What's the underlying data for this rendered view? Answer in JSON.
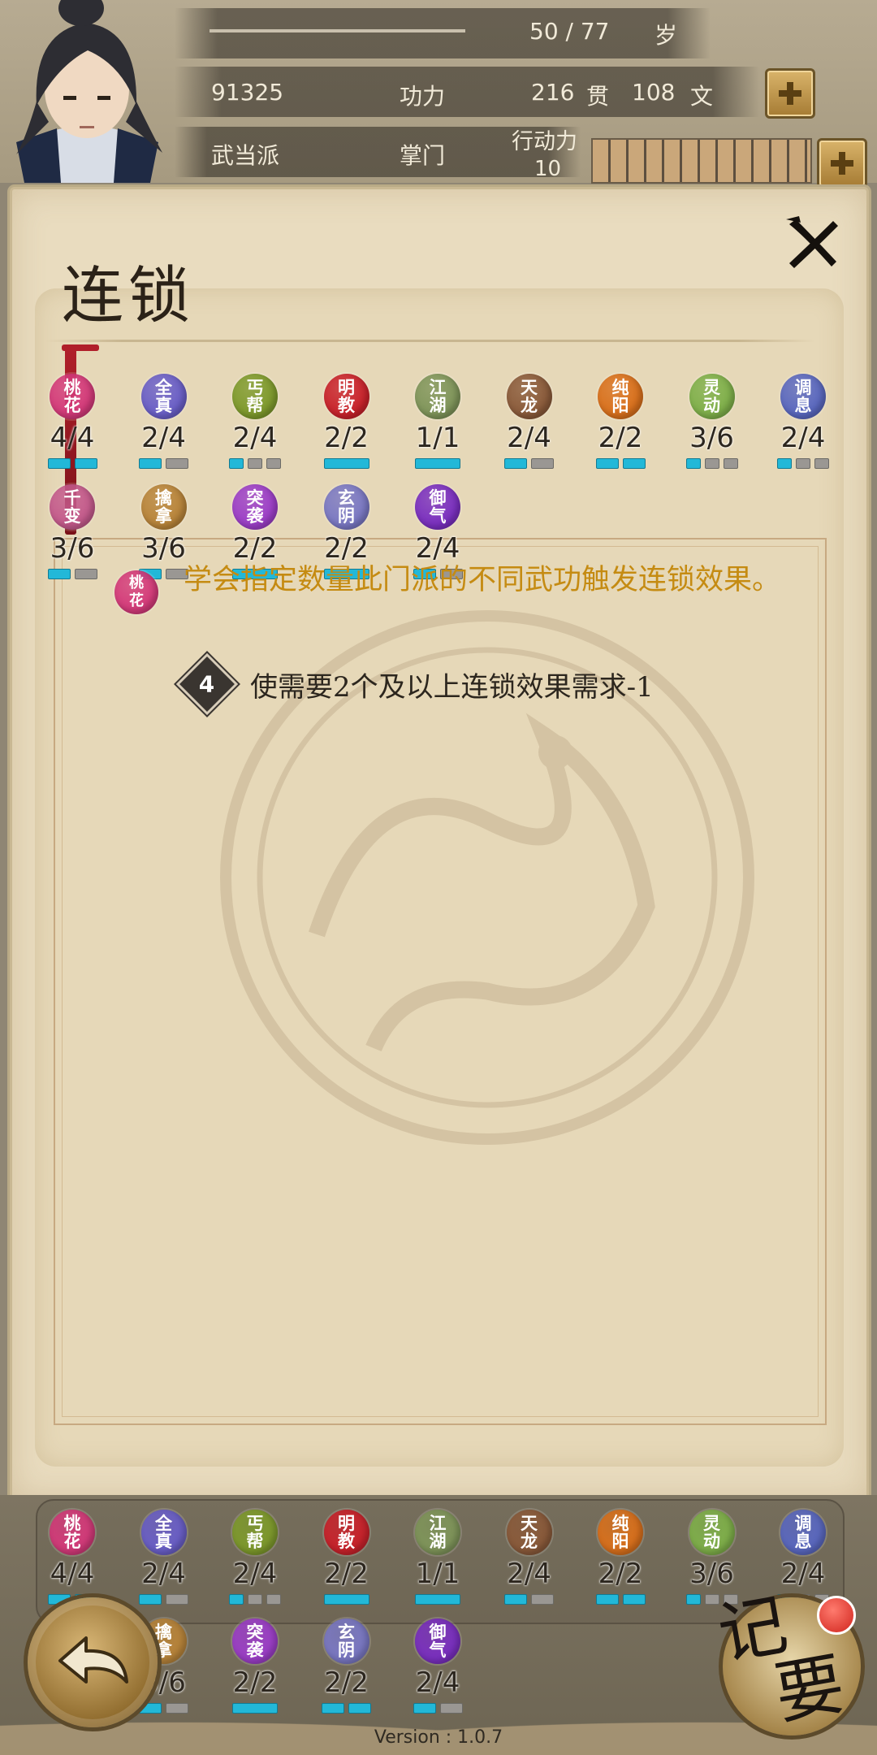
{
  "header": {
    "age": "50 / 77",
    "age_unit": "岁",
    "power_value": "91325",
    "power_label": "功力",
    "money_guan": "216",
    "guan_label": "贯",
    "money_wen": "108",
    "wen_label": "文",
    "sect": "武当派",
    "rank": "掌门",
    "action_label": "行动力",
    "action_value": "10",
    "action_fill": 1.0
  },
  "panel": {
    "title": "连锁"
  },
  "colors": {
    "pip_on": "#22b8d8",
    "pip_off": "#9a9793",
    "desc_gold": "#c58b12"
  },
  "sects": [
    {
      "name": "桃花",
      "count": "4/4",
      "on": 2,
      "total": 2,
      "color": "#d43a7a"
    },
    {
      "name": "全真",
      "count": "2/4",
      "on": 1,
      "total": 2,
      "color": "#6a5fc8"
    },
    {
      "name": "丐帮",
      "count": "2/4",
      "on": 1,
      "total": 3,
      "color": "#7e9a2c"
    },
    {
      "name": "明教",
      "count": "2/2",
      "on": 1,
      "total": 1,
      "color": "#c9222b"
    },
    {
      "name": "江湖",
      "count": "1/1",
      "on": 1,
      "total": 1,
      "color": "#7f955a"
    },
    {
      "name": "天龙",
      "count": "2/4",
      "on": 1,
      "total": 2,
      "color": "#8a5a3a"
    },
    {
      "name": "纯阳",
      "count": "2/2",
      "on": 2,
      "total": 2,
      "color": "#d9701c"
    },
    {
      "name": "灵动",
      "count": "3/6",
      "on": 1,
      "total": 3,
      "color": "#7fb04a"
    },
    {
      "name": "调息",
      "count": "2/4",
      "on": 1,
      "total": 3,
      "color": "#5a68c0"
    },
    {
      "name": "千变",
      "count": "3/6",
      "on": 1,
      "total": 2,
      "color": "#c45a8c"
    },
    {
      "name": "擒拿",
      "count": "3/6",
      "on": 1,
      "total": 2,
      "color": "#b8843a"
    },
    {
      "name": "突袭",
      "count": "2/2",
      "on": 1,
      "total": 1,
      "color": "#9c3ec8"
    },
    {
      "name": "玄阴",
      "count": "2/2",
      "on": 1,
      "total": 1,
      "color": "#7a78c4"
    },
    {
      "name": "御气",
      "count": "2/4",
      "on": 1,
      "total": 2,
      "color": "#7a2fc0"
    }
  ],
  "description": {
    "text": "学会指定数量此门派的不同武功触发连锁效果。",
    "small_badge": "桃花",
    "effect_level": "4",
    "effect_text": "使需要2个及以上连锁效果需求-1"
  },
  "bottom_sects": [
    {
      "name": "桃花",
      "count": "4/4",
      "on": 2,
      "total": 2,
      "color": "#d43a7a"
    },
    {
      "name": "全真",
      "count": "2/4",
      "on": 1,
      "total": 2,
      "color": "#6a5fc8"
    },
    {
      "name": "丐帮",
      "count": "2/4",
      "on": 1,
      "total": 3,
      "color": "#7e9a2c"
    },
    {
      "name": "明教",
      "count": "2/2",
      "on": 1,
      "total": 1,
      "color": "#c9222b"
    },
    {
      "name": "江湖",
      "count": "1/1",
      "on": 1,
      "total": 1,
      "color": "#7f955a"
    },
    {
      "name": "天龙",
      "count": "2/4",
      "on": 1,
      "total": 2,
      "color": "#8a5a3a"
    },
    {
      "name": "纯阳",
      "count": "2/2",
      "on": 2,
      "total": 2,
      "color": "#d9701c"
    },
    {
      "name": "灵动",
      "count": "3/6",
      "on": 1,
      "total": 3,
      "color": "#7fb04a"
    },
    {
      "name": "调息",
      "count": "2/4",
      "on": 1,
      "total": 3,
      "color": "#5a68c0"
    },
    {
      "name": "擒拿",
      "count": "3/6",
      "on": 1,
      "total": 2,
      "color": "#b8843a"
    },
    {
      "name": "突袭",
      "count": "2/2",
      "on": 1,
      "total": 1,
      "color": "#9c3ec8"
    },
    {
      "name": "玄阴",
      "count": "2/2",
      "on": 2,
      "total": 2,
      "color": "#7a78c4"
    },
    {
      "name": "御气",
      "count": "2/4",
      "on": 1,
      "total": 2,
      "color": "#7a2fc0"
    }
  ],
  "footer": {
    "memo_label_1": "记",
    "memo_label_2": "要",
    "version": "Version : 1.0.7"
  }
}
